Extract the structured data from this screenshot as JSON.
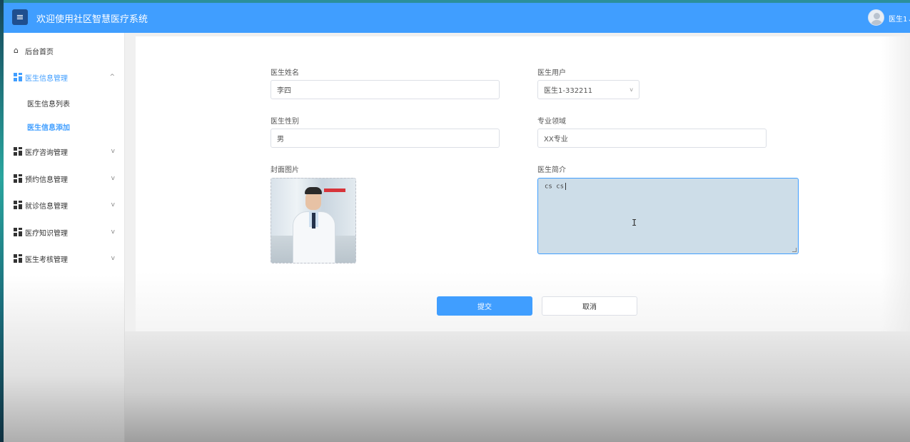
{
  "header": {
    "menu_icon": "hamburger-icon",
    "title": "欢迎使用社区智慧医疗系统",
    "user_name": "医生1",
    "user_chevron": "⌄"
  },
  "sidebar": {
    "home": "后台首页",
    "groups": [
      {
        "label": "医生信息管理",
        "expanded": true,
        "sub": [
          "医生信息列表",
          "医生信息添加"
        ],
        "current": "医生信息添加"
      },
      {
        "label": "医疗咨询管理"
      },
      {
        "label": "预约信息管理"
      },
      {
        "label": "就诊信息管理"
      },
      {
        "label": "医疗知识管理"
      },
      {
        "label": "医生考核管理"
      }
    ],
    "chevron_up": "^",
    "chevron_down": "v"
  },
  "form": {
    "doctor_name_label": "医生姓名",
    "doctor_name_value": "李四",
    "doctor_user_label": "医生用户",
    "doctor_user_value": "医生1-332211",
    "doctor_gender_label": "医生性别",
    "doctor_gender_value": "男",
    "specialty_label": "专业领域",
    "specialty_value": "XX专业",
    "cover_label": "封面图片",
    "intro_label": "医生简介",
    "intro_value": "cs cs",
    "submit_label": "提交",
    "cancel_label": "取消"
  },
  "colors": {
    "accent": "#409eff",
    "header_bg": "#409eff",
    "menu_button_bg": "#1f4f8f"
  }
}
